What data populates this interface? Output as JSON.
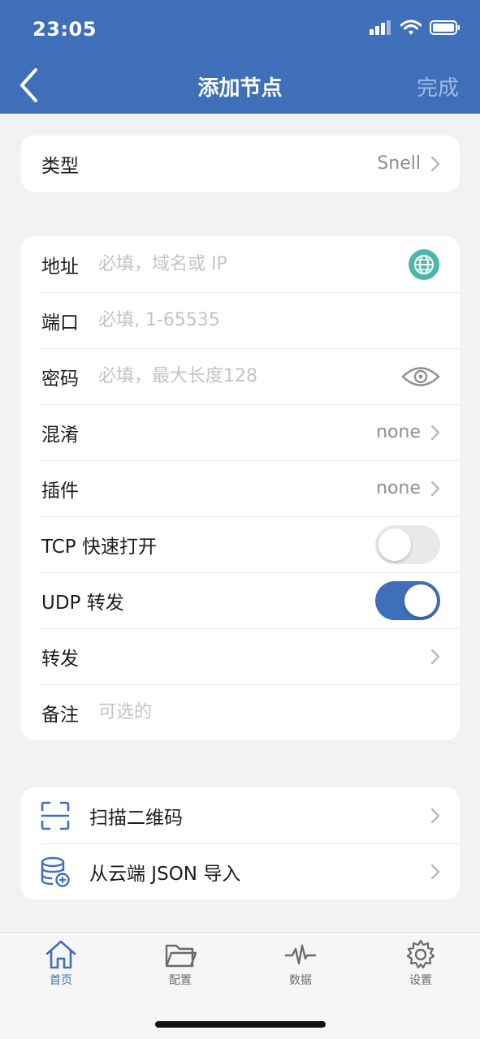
{
  "status_bar": {
    "time": "23:05"
  },
  "nav": {
    "title": "添加节点",
    "done_label": "完成"
  },
  "type_row": {
    "label": "类型",
    "value": "Snell"
  },
  "form": {
    "address": {
      "label": "地址",
      "placeholder": "必填，域名或 IP"
    },
    "port": {
      "label": "端口",
      "placeholder": "必填, 1-65535"
    },
    "password": {
      "label": "密码",
      "placeholder": "必填，最大长度128"
    },
    "obfs": {
      "label": "混淆",
      "value": "none"
    },
    "plugin": {
      "label": "插件",
      "value": "none"
    },
    "tcp_fast_open": {
      "label": "TCP 快速打开",
      "on": false
    },
    "udp_relay": {
      "label": "UDP 转发",
      "on": true
    },
    "forward": {
      "label": "转发"
    },
    "note": {
      "label": "备注",
      "placeholder": "可选的"
    }
  },
  "actions": {
    "scan_qr": {
      "label": "扫描二维码",
      "icon": "scan-icon"
    },
    "import_json": {
      "label": "从云端 JSON 导入",
      "icon": "database-add-icon"
    }
  },
  "tabs": [
    {
      "label": "首页",
      "icon": "home-icon",
      "active": true
    },
    {
      "label": "配置",
      "icon": "folder-icon",
      "active": false
    },
    {
      "label": "数据",
      "icon": "activity-icon",
      "active": false
    },
    {
      "label": "设置",
      "icon": "gear-icon",
      "active": false
    }
  ],
  "colors": {
    "accent": "#3e6fb8",
    "background": "#f2f2f2",
    "globe": "#4db6ac"
  }
}
